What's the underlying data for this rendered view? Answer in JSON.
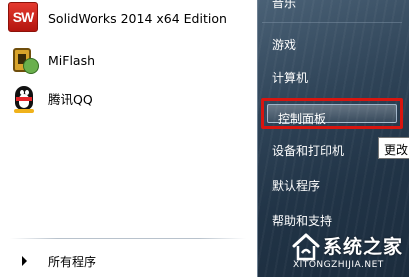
{
  "programs": [
    {
      "label": "SolidWorks 2014 x64 Edition",
      "icon": "solidworks-icon",
      "icon_text": "SW"
    },
    {
      "label": "MiFlash",
      "icon": "miflash-icon"
    },
    {
      "label": "腾讯QQ",
      "icon": "qq-penguin-icon"
    }
  ],
  "all_programs_label": "所有程序",
  "right_items": [
    "音乐",
    "游戏",
    "计算机",
    "控制面板",
    "设备和打印机",
    "默认程序",
    "帮助和支持"
  ],
  "tooltip": "更改",
  "watermark": {
    "text": "系统之家",
    "url": "XITONGZHIJIA.NET"
  },
  "colors": {
    "highlight_border": "#d8150f",
    "right_pane": "#2f4458"
  }
}
